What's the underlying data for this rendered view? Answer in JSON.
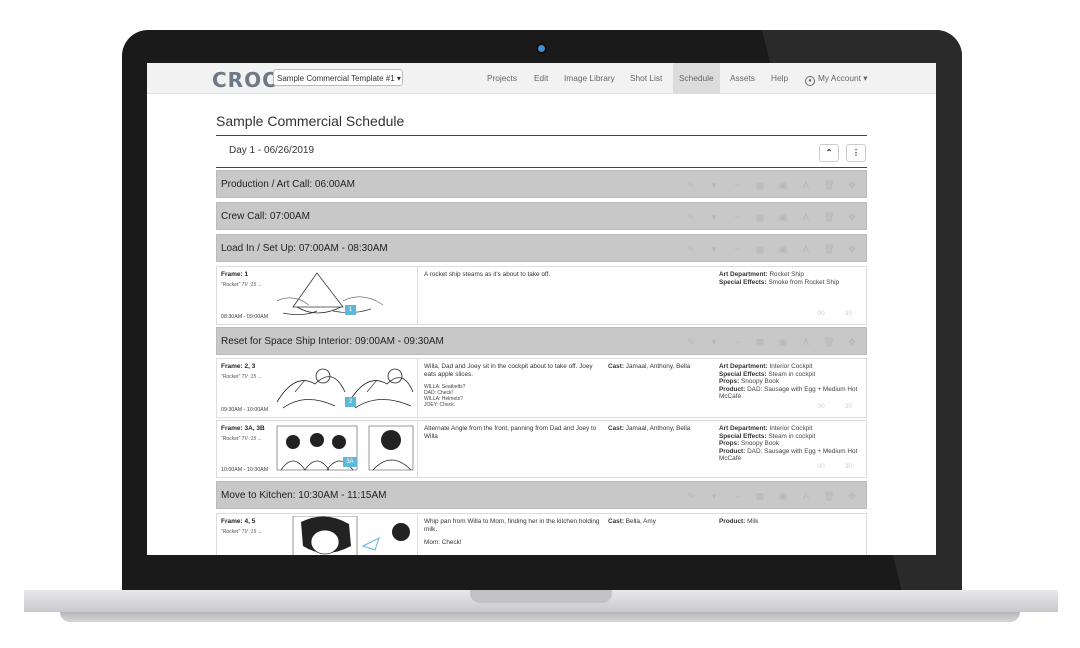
{
  "app": {
    "logo": "CROO",
    "project_select": "Sample Commercial Template #1 ▾"
  },
  "nav": {
    "items": [
      "Projects",
      "Edit",
      "Image Library",
      "Shot List",
      "Schedule",
      "Assets",
      "Help",
      "My Account ▾"
    ],
    "active": "Schedule"
  },
  "page": {
    "title": "Sample Commercial Schedule",
    "day_label": "Day 1 - 06/26/2019",
    "collapse_icon": "chevron-up-icon",
    "menu_icon": "vertical-dots-icon"
  },
  "bars": [
    {
      "label": "Production / Art Call: 06:00AM"
    },
    {
      "label": "Crew Call: 07:00AM"
    },
    {
      "label": "Load In / Set Up: 07:00AM - 08:30AM"
    },
    {
      "label": "Reset for Space Ship Interior: 09:00AM - 09:30AM"
    },
    {
      "label": "Move to Kitchen: 10:30AM - 11:15AM"
    }
  ],
  "bar_tool_icons": [
    "pencil-icon",
    "chevron-down-icon",
    "minus-icon",
    "grid-icon",
    "image-icon",
    "font-icon",
    "trash-icon",
    "move-icon"
  ],
  "shots": [
    {
      "frame": "Frame: 1",
      "sub": "\"Rocket\" TV :15 ...",
      "time": "08:30AM - 09:00AM",
      "badge": "1",
      "description": "A rocket ship steams as it's about to take off.",
      "dialog": [],
      "cast": "",
      "depts": [
        {
          "k": "Art Department:",
          "v": "Rocket Ship"
        },
        {
          "k": "Special Effects:",
          "v": "Smoke from Rocket Ship"
        }
      ],
      "nums": [
        "00",
        "30"
      ]
    },
    {
      "frame": "Frame: 2, 3",
      "sub": "\"Rocket\" TV :15 ...",
      "time": "09:30AM - 10:00AM",
      "badge": "2",
      "description": "Willa, Dad and Joey sit in the cockpit about to take off.  Joey eats apple slices.",
      "dialog": [
        "WILLA: Seatbelts?",
        "DAD: Check!",
        "WILLA: Helmets?",
        "JOEY: Check."
      ],
      "cast": "Jamaal, Anthony, Bella",
      "depts": [
        {
          "k": "Art Department:",
          "v": "Interior Cockpit"
        },
        {
          "k": "Special Effects:",
          "v": "Steam in cockpit"
        },
        {
          "k": "Props:",
          "v": "Snoopy Book"
        },
        {
          "k": "Product:",
          "v": "DAD: Sausage with Egg + Medium Hot McCafé"
        }
      ],
      "nums": [
        "00",
        "30"
      ]
    },
    {
      "frame": "Frame: 3A, 3B",
      "sub": "\"Rocket\" TV :15 ...",
      "time": "10:00AM - 10:30AM",
      "badge": "3A",
      "description": "Alternate Angle from the front, panning from Dad and Joey to Willa",
      "dialog": [],
      "cast": "Jamaal, Anthony, Bella",
      "depts": [
        {
          "k": "Art Department:",
          "v": "Interior Cockpit"
        },
        {
          "k": "Special Effects:",
          "v": "Steam in cockpit"
        },
        {
          "k": "Props:",
          "v": "Snoopy Book"
        },
        {
          "k": "Product:",
          "v": "DAD: Sausage with Egg + Medium Hot McCafé"
        }
      ],
      "nums": [
        "00",
        "30"
      ]
    },
    {
      "frame": "Frame: 4, 5",
      "sub": "\"Rocket\" TV :15 ...",
      "time": "",
      "badge": "4",
      "description": "Whip pan from Willa to Mom, finding her in the kitchen holding milk.",
      "dialog_text": "Mom:  Check!",
      "dialog": [],
      "cast": "Bella, Amy",
      "depts": [
        {
          "k": "Product:",
          "v": "Milk"
        }
      ],
      "nums": []
    }
  ]
}
